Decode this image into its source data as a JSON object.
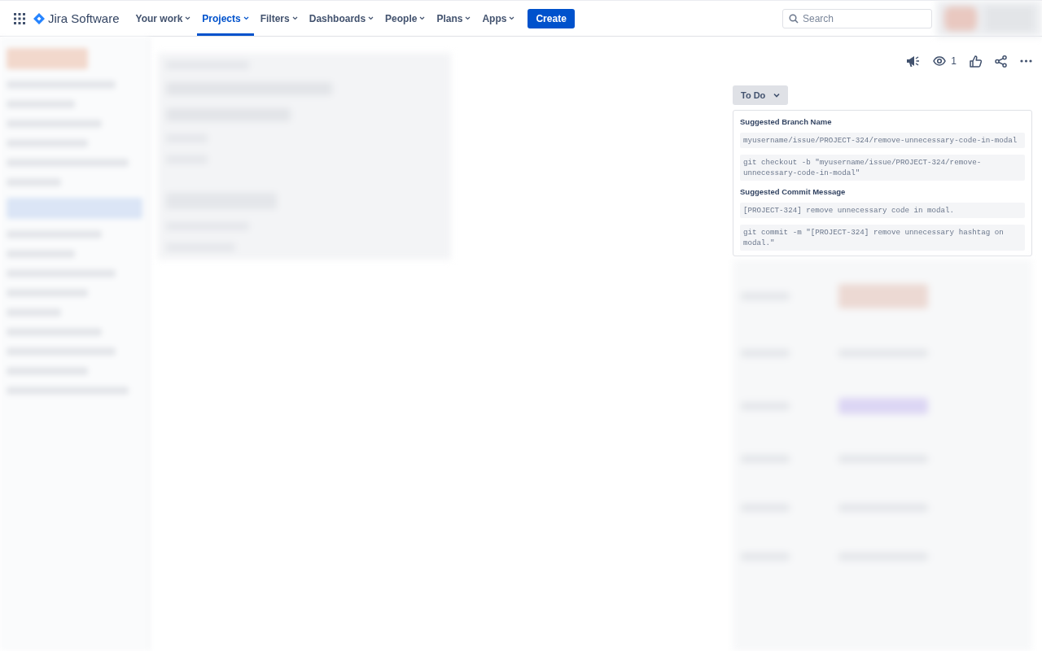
{
  "app": {
    "product": "Jira Software"
  },
  "nav": [
    {
      "label": "Your work",
      "selected": false
    },
    {
      "label": "Projects",
      "selected": true
    },
    {
      "label": "Filters",
      "selected": false
    },
    {
      "label": "Dashboards",
      "selected": false
    },
    {
      "label": "People",
      "selected": false
    },
    {
      "label": "Plans",
      "selected": false
    },
    {
      "label": "Apps",
      "selected": false
    }
  ],
  "create_button": "Create",
  "search": {
    "placeholder": "Search"
  },
  "issue_actions": {
    "watchers": "1"
  },
  "status": "To Do",
  "git_panel": {
    "sections": [
      {
        "title": "Suggested Branch Name",
        "snippets": [
          "myusername/issue/PROJECT-324/remove-unnecessary-code-in-modal",
          "git checkout -b \"myusername/issue/PROJECT-324/remove-unnecessary-code-in-modal\""
        ]
      },
      {
        "title": "Suggested Commit Message",
        "snippets": [
          "[PROJECT-324] remove unnecessary code in modal.",
          "git commit -m \"[PROJECT-324] remove unnecessary hashtag on modal.\""
        ]
      }
    ]
  }
}
